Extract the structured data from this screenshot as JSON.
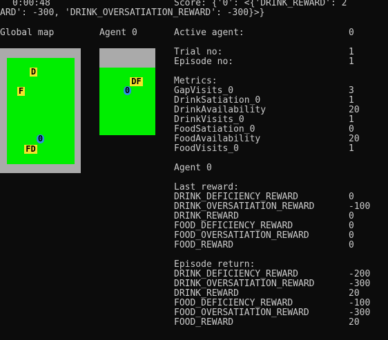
{
  "header": {
    "time": "0:00:48",
    "score_line1": "Score: {'0': <{'DRINK_REWARD': 2",
    "score_line2": "ARD': -300, 'DRINK_OVERSATIATION_REWARD': -300}>}"
  },
  "global_map": {
    "title": "Global map",
    "cells": [
      {
        "label": "D",
        "kind": "food-drink"
      },
      {
        "label": "F",
        "kind": "food-drink"
      },
      {
        "label": "0",
        "kind": "agent"
      },
      {
        "label": "FD",
        "kind": "food-drink"
      }
    ],
    "colors": {
      "wall": "#aaaaaa",
      "grass": "#00ee00"
    }
  },
  "agent_view": {
    "title": "Agent 0",
    "cells": [
      {
        "label": "DF",
        "kind": "food-drink"
      },
      {
        "label": "0",
        "kind": "agent"
      }
    ],
    "colors": {
      "wall": "#aaaaaa",
      "grass": "#00ee00"
    }
  },
  "info": {
    "active_agent_label": "Active agent:",
    "active_agent_value": "0",
    "trial_label": "Trial no:",
    "trial_value": "1",
    "episode_label": "Episode no:",
    "episode_value": "1",
    "metrics_title": "Metrics:",
    "metrics": [
      {
        "name": "GapVisits_0",
        "value": "3"
      },
      {
        "name": "DrinkSatiation_0",
        "value": "1"
      },
      {
        "name": "DrinkAvailability",
        "value": "20"
      },
      {
        "name": "DrinkVisits_0",
        "value": "1"
      },
      {
        "name": "FoodSatiation_0",
        "value": "0"
      },
      {
        "name": "FoodAvailability",
        "value": "20"
      },
      {
        "name": "FoodVisits_0",
        "value": "1"
      }
    ],
    "agent_heading": "Agent 0",
    "last_reward_title": "Last reward:",
    "last_reward": [
      {
        "name": "DRINK_DEFICIENCY_REWARD",
        "value": "0"
      },
      {
        "name": "DRINK_OVERSATIATION_REWARD",
        "value": "-100"
      },
      {
        "name": "DRINK_REWARD",
        "value": "0"
      },
      {
        "name": "FOOD_DEFICIENCY_REWARD",
        "value": "0"
      },
      {
        "name": "FOOD_OVERSATIATION_REWARD",
        "value": "0"
      },
      {
        "name": "FOOD_REWARD",
        "value": "0"
      }
    ],
    "episode_return_title": "Episode return:",
    "episode_return": [
      {
        "name": "DRINK_DEFICIENCY_REWARD",
        "value": "-200"
      },
      {
        "name": "DRINK_OVERSATIATION_REWARD",
        "value": "-300"
      },
      {
        "name": "DRINK_REWARD",
        "value": "20"
      },
      {
        "name": "FOOD_DEFICIENCY_REWARD",
        "value": "-100"
      },
      {
        "name": "FOOD_OVERSATIATION_REWARD",
        "value": "-300"
      },
      {
        "name": "FOOD_REWARD",
        "value": "20"
      }
    ]
  }
}
